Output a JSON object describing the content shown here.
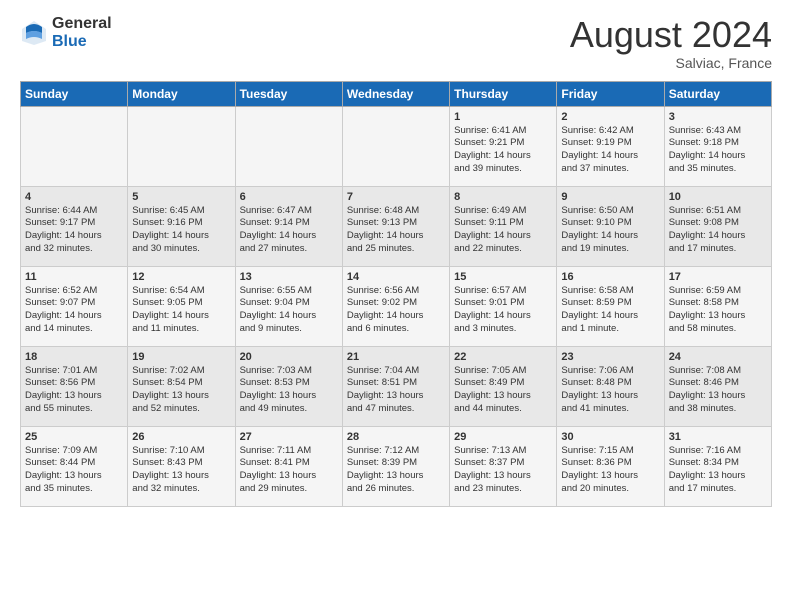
{
  "logo": {
    "general": "General",
    "blue": "Blue"
  },
  "header": {
    "month_year": "August 2024",
    "location": "Salviac, France"
  },
  "days_of_week": [
    "Sunday",
    "Monday",
    "Tuesday",
    "Wednesday",
    "Thursday",
    "Friday",
    "Saturday"
  ],
  "weeks": [
    [
      {
        "day": "",
        "info": ""
      },
      {
        "day": "",
        "info": ""
      },
      {
        "day": "",
        "info": ""
      },
      {
        "day": "",
        "info": ""
      },
      {
        "day": "1",
        "info": "Sunrise: 6:41 AM\nSunset: 9:21 PM\nDaylight: 14 hours\nand 39 minutes."
      },
      {
        "day": "2",
        "info": "Sunrise: 6:42 AM\nSunset: 9:19 PM\nDaylight: 14 hours\nand 37 minutes."
      },
      {
        "day": "3",
        "info": "Sunrise: 6:43 AM\nSunset: 9:18 PM\nDaylight: 14 hours\nand 35 minutes."
      }
    ],
    [
      {
        "day": "4",
        "info": "Sunrise: 6:44 AM\nSunset: 9:17 PM\nDaylight: 14 hours\nand 32 minutes."
      },
      {
        "day": "5",
        "info": "Sunrise: 6:45 AM\nSunset: 9:16 PM\nDaylight: 14 hours\nand 30 minutes."
      },
      {
        "day": "6",
        "info": "Sunrise: 6:47 AM\nSunset: 9:14 PM\nDaylight: 14 hours\nand 27 minutes."
      },
      {
        "day": "7",
        "info": "Sunrise: 6:48 AM\nSunset: 9:13 PM\nDaylight: 14 hours\nand 25 minutes."
      },
      {
        "day": "8",
        "info": "Sunrise: 6:49 AM\nSunset: 9:11 PM\nDaylight: 14 hours\nand 22 minutes."
      },
      {
        "day": "9",
        "info": "Sunrise: 6:50 AM\nSunset: 9:10 PM\nDaylight: 14 hours\nand 19 minutes."
      },
      {
        "day": "10",
        "info": "Sunrise: 6:51 AM\nSunset: 9:08 PM\nDaylight: 14 hours\nand 17 minutes."
      }
    ],
    [
      {
        "day": "11",
        "info": "Sunrise: 6:52 AM\nSunset: 9:07 PM\nDaylight: 14 hours\nand 14 minutes."
      },
      {
        "day": "12",
        "info": "Sunrise: 6:54 AM\nSunset: 9:05 PM\nDaylight: 14 hours\nand 11 minutes."
      },
      {
        "day": "13",
        "info": "Sunrise: 6:55 AM\nSunset: 9:04 PM\nDaylight: 14 hours\nand 9 minutes."
      },
      {
        "day": "14",
        "info": "Sunrise: 6:56 AM\nSunset: 9:02 PM\nDaylight: 14 hours\nand 6 minutes."
      },
      {
        "day": "15",
        "info": "Sunrise: 6:57 AM\nSunset: 9:01 PM\nDaylight: 14 hours\nand 3 minutes."
      },
      {
        "day": "16",
        "info": "Sunrise: 6:58 AM\nSunset: 8:59 PM\nDaylight: 14 hours\nand 1 minute."
      },
      {
        "day": "17",
        "info": "Sunrise: 6:59 AM\nSunset: 8:58 PM\nDaylight: 13 hours\nand 58 minutes."
      }
    ],
    [
      {
        "day": "18",
        "info": "Sunrise: 7:01 AM\nSunset: 8:56 PM\nDaylight: 13 hours\nand 55 minutes."
      },
      {
        "day": "19",
        "info": "Sunrise: 7:02 AM\nSunset: 8:54 PM\nDaylight: 13 hours\nand 52 minutes."
      },
      {
        "day": "20",
        "info": "Sunrise: 7:03 AM\nSunset: 8:53 PM\nDaylight: 13 hours\nand 49 minutes."
      },
      {
        "day": "21",
        "info": "Sunrise: 7:04 AM\nSunset: 8:51 PM\nDaylight: 13 hours\nand 47 minutes."
      },
      {
        "day": "22",
        "info": "Sunrise: 7:05 AM\nSunset: 8:49 PM\nDaylight: 13 hours\nand 44 minutes."
      },
      {
        "day": "23",
        "info": "Sunrise: 7:06 AM\nSunset: 8:48 PM\nDaylight: 13 hours\nand 41 minutes."
      },
      {
        "day": "24",
        "info": "Sunrise: 7:08 AM\nSunset: 8:46 PM\nDaylight: 13 hours\nand 38 minutes."
      }
    ],
    [
      {
        "day": "25",
        "info": "Sunrise: 7:09 AM\nSunset: 8:44 PM\nDaylight: 13 hours\nand 35 minutes."
      },
      {
        "day": "26",
        "info": "Sunrise: 7:10 AM\nSunset: 8:43 PM\nDaylight: 13 hours\nand 32 minutes."
      },
      {
        "day": "27",
        "info": "Sunrise: 7:11 AM\nSunset: 8:41 PM\nDaylight: 13 hours\nand 29 minutes."
      },
      {
        "day": "28",
        "info": "Sunrise: 7:12 AM\nSunset: 8:39 PM\nDaylight: 13 hours\nand 26 minutes."
      },
      {
        "day": "29",
        "info": "Sunrise: 7:13 AM\nSunset: 8:37 PM\nDaylight: 13 hours\nand 23 minutes."
      },
      {
        "day": "30",
        "info": "Sunrise: 7:15 AM\nSunset: 8:36 PM\nDaylight: 13 hours\nand 20 minutes."
      },
      {
        "day": "31",
        "info": "Sunrise: 7:16 AM\nSunset: 8:34 PM\nDaylight: 13 hours\nand 17 minutes."
      }
    ]
  ]
}
